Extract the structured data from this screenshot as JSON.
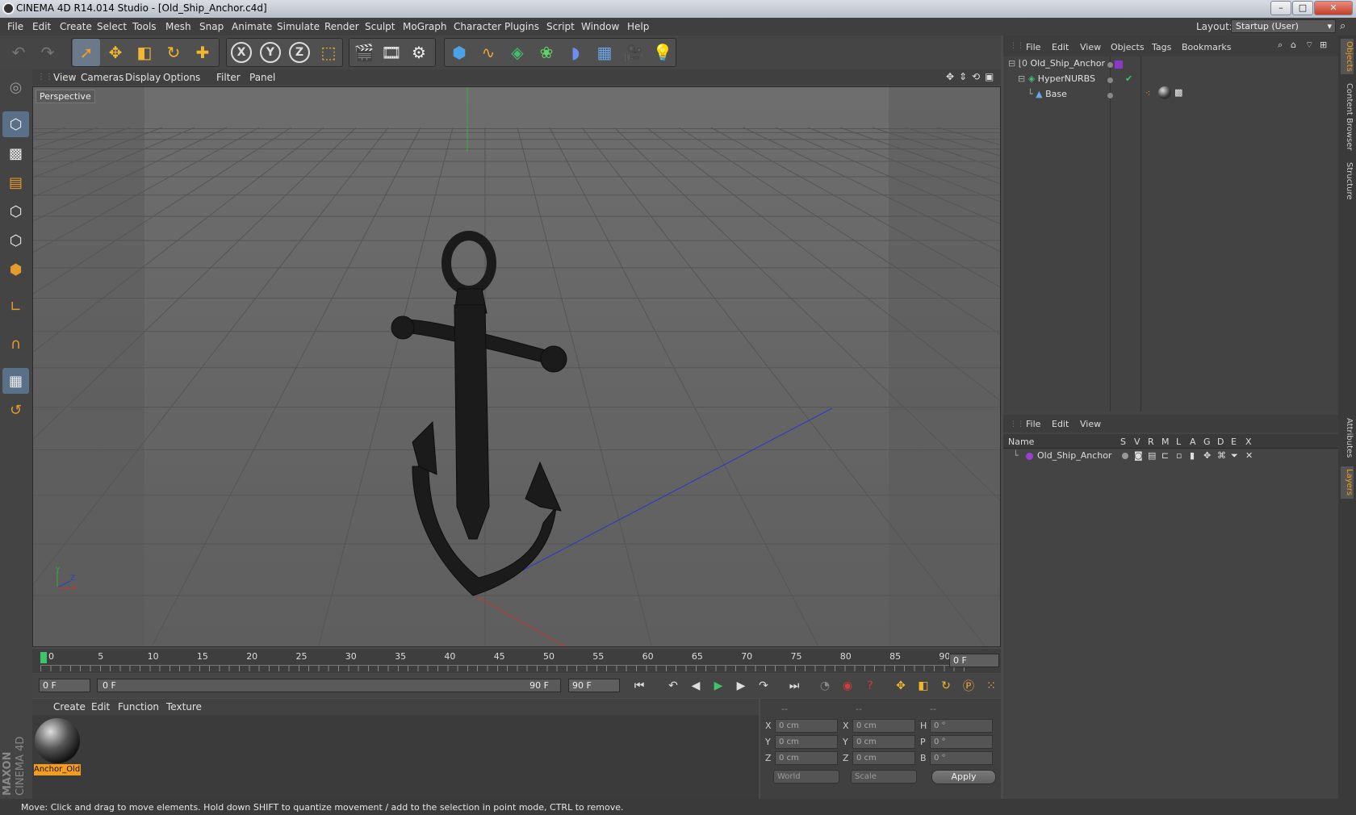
{
  "window": {
    "title": "CINEMA 4D R14.014 Studio - [Old_Ship_Anchor.c4d]",
    "minimize": "–",
    "maximize": "□",
    "close": "✕"
  },
  "menu": {
    "items": [
      "File",
      "Edit",
      "Create",
      "Select",
      "Tools",
      "Mesh",
      "Snap",
      "Animate",
      "Simulate",
      "Render",
      "Sculpt",
      "MoGraph",
      "Character",
      "Plugins",
      "Script",
      "Window",
      "Help"
    ],
    "layout_label": "Layout:",
    "layout_value": "Startup (User)"
  },
  "toolbar": {
    "icons": [
      "undo-icon",
      "redo-icon",
      "live-selection-icon",
      "move-icon",
      "scale-icon",
      "rotate-icon",
      "add-icon",
      "x-axis-icon",
      "y-axis-icon",
      "z-axis-icon",
      "world-coord-icon",
      "render-view-icon",
      "render-picture-viewer-icon",
      "edit-render-settings-icon",
      "cube-icon",
      "spline-pen-icon",
      "subdivision-icon",
      "cloner-icon",
      "deformer-icon",
      "floor-icon",
      "camera-icon",
      "light-icon"
    ],
    "axis_labels": [
      "X",
      "Y",
      "Z"
    ]
  },
  "viewport": {
    "menu": [
      "View",
      "Cameras",
      "Display",
      "Options",
      "Filter",
      "Panel"
    ],
    "label": "Perspective",
    "axis_labels": [
      "Y",
      "Z",
      "X"
    ]
  },
  "timeline": {
    "ticks": [
      "0",
      "5",
      "10",
      "15",
      "20",
      "25",
      "30",
      "35",
      "40",
      "45",
      "50",
      "55",
      "60",
      "65",
      "70",
      "75",
      "80",
      "85",
      "90"
    ],
    "current_frame": "0 F"
  },
  "transport": {
    "start": "0 F",
    "range_start": "0 F",
    "range_end": "90 F",
    "end": "90 F"
  },
  "materials": {
    "menu": [
      "Create",
      "Edit",
      "Function",
      "Texture"
    ],
    "items": [
      {
        "name": "Anchor_Old"
      }
    ]
  },
  "coordinates": {
    "header": [
      "--",
      "--",
      "--"
    ],
    "rows": [
      {
        "a": "X",
        "av": "0 cm",
        "b": "X",
        "bv": "0 cm",
        "c": "H",
        "cv": "0 °"
      },
      {
        "a": "Y",
        "av": "0 cm",
        "b": "Y",
        "bv": "0 cm",
        "c": "P",
        "cv": "0 °"
      },
      {
        "a": "Z",
        "av": "0 cm",
        "b": "Z",
        "bv": "0 cm",
        "c": "B",
        "cv": "0 °"
      }
    ],
    "world": "World",
    "scale": "Scale",
    "apply": "Apply"
  },
  "objects": {
    "menu": [
      "File",
      "Edit",
      "View",
      "Objects",
      "Tags",
      "Bookmarks"
    ],
    "tree": [
      {
        "name": "Old_Ship_Anchor",
        "icon": "null-icon"
      },
      {
        "name": "HyperNURBS",
        "icon": "hypernurbs-icon"
      },
      {
        "name": "Base",
        "icon": "polygon-icon"
      }
    ]
  },
  "layers": {
    "menu": [
      "File",
      "Edit",
      "View"
    ],
    "columns": [
      "Name",
      "S",
      "V",
      "R",
      "M",
      "L",
      "A",
      "G",
      "D",
      "E",
      "X"
    ],
    "rows": [
      {
        "name": "Old_Ship_Anchor",
        "color": "#9b3fd4"
      }
    ]
  },
  "side_tabs": [
    "Objects",
    "Content Browser",
    "Structure",
    "Attributes",
    "Layers"
  ],
  "brand": {
    "maxon": "MAXON",
    "c4d": "CINEMA 4D"
  },
  "status": "Move: Click and drag to move elements. Hold down SHIFT to quantize movement / add to the selection in point mode, CTRL to remove.",
  "colors": {
    "accent": "#f39c1f",
    "axis_x": "#c23a2a",
    "axis_y": "#3aa83a",
    "axis_z": "#3040c8",
    "playhead": "#3ec46b"
  }
}
